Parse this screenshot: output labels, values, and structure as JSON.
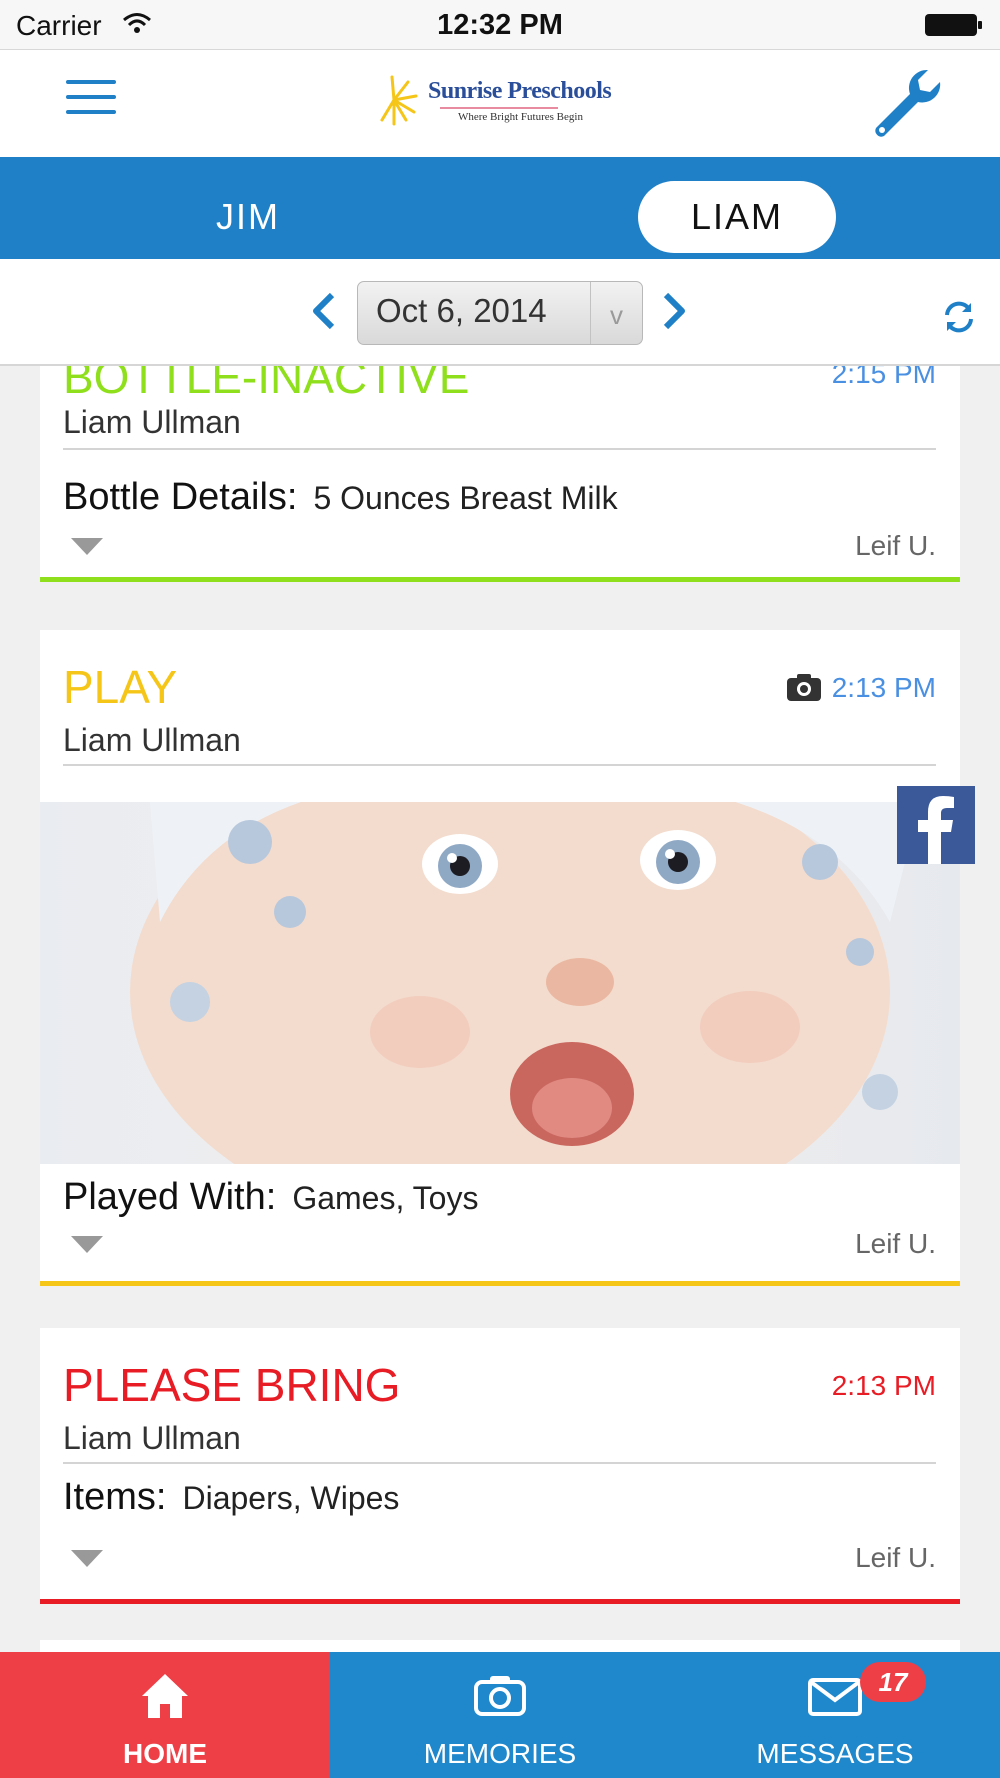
{
  "status_bar": {
    "carrier": "Carrier",
    "time": "12:32 PM",
    "wifi_icon": "wifi-icon",
    "battery_icon": "battery-icon"
  },
  "header": {
    "menu_icon": "hamburger-menu-icon",
    "logo": {
      "name": "Sunrise Preschools",
      "tagline": "Where Bright Futures Begin"
    },
    "settings_icon": "wrench-icon",
    "accent_color": "#1f80c8"
  },
  "child_tabs": [
    {
      "label": "JIM",
      "selected": false
    },
    {
      "label": "LIAM",
      "selected": true
    }
  ],
  "date_picker": {
    "value": "Oct 6, 2014",
    "caret": "v",
    "prev_icon": "chevron-left-icon",
    "next_icon": "chevron-right-icon",
    "refresh_icon": "refresh-icon"
  },
  "feed": {
    "cards": [
      {
        "title": "BOTTLE-INACTIVE",
        "title_color": "#8fdf1c",
        "time": "2:15 PM",
        "time_color": "#4a90e2",
        "child": "Liam Ullman",
        "detail_label": "Bottle Details:",
        "detail_value": "5 Ounces Breast Milk",
        "author": "Leif U.",
        "bar_color": "#8fdf1c"
      },
      {
        "title": "PLAY",
        "title_color": "#f5c518",
        "time": "2:13 PM",
        "time_color": "#4a90e2",
        "has_photo": true,
        "child": "Liam Ullman",
        "detail_label": "Played With:",
        "detail_value": "Games, Toys",
        "author": "Leif U.",
        "bar_color": "#f5c518"
      },
      {
        "title": "PLEASE BRING",
        "title_color": "#e81c24",
        "time": "2:13 PM",
        "time_color": "#e81c24",
        "child": "Liam Ullman",
        "detail_label": "Items:",
        "detail_value": "Diapers, Wipes",
        "author": "Leif U.",
        "bar_color": "#e81c24"
      }
    ],
    "share_icon": "facebook-icon"
  },
  "bottom_nav": {
    "items": [
      {
        "label": "HOME",
        "icon": "home-icon",
        "active": true
      },
      {
        "label": "MEMORIES",
        "icon": "camera-icon",
        "active": false
      },
      {
        "label": "MESSAGES",
        "icon": "envelope-icon",
        "active": false
      }
    ],
    "messages_badge": "17"
  }
}
